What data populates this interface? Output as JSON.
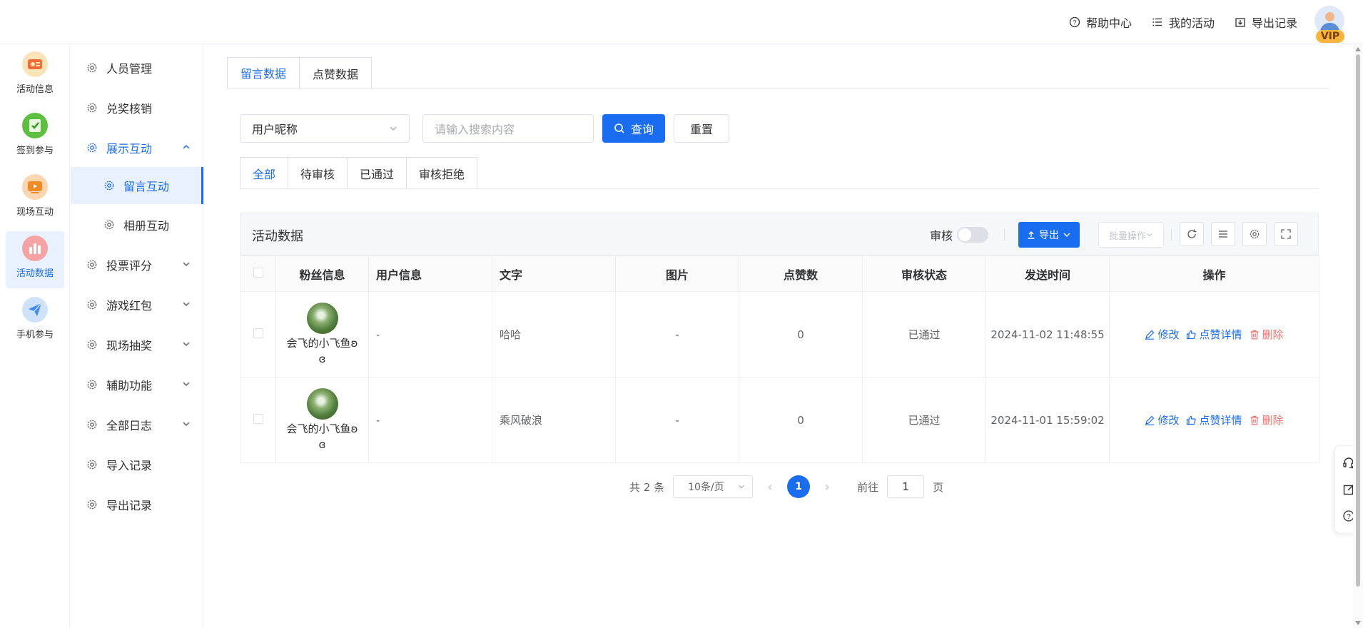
{
  "topbar": {
    "links": [
      {
        "label": "帮助中心",
        "icon": "help-circle-icon"
      },
      {
        "label": "我的活动",
        "icon": "list-icon"
      },
      {
        "label": "导出记录",
        "icon": "export-box-icon"
      }
    ],
    "vip_badge": "VIP"
  },
  "rail": {
    "items": [
      {
        "label": "活动信息",
        "icon": "activity-info-icon",
        "color": "#f5a623"
      },
      {
        "label": "签到参与",
        "icon": "checkin-icon",
        "color": "#43b244"
      },
      {
        "label": "现场互动",
        "icon": "live-interaction-icon",
        "color": "#f08a24"
      },
      {
        "label": "活动数据",
        "icon": "bar-chart-icon",
        "color": "#f26b6b"
      },
      {
        "label": "手机参与",
        "icon": "paper-plane-icon",
        "color": "#3d8bf2"
      }
    ]
  },
  "submenu": {
    "items": [
      {
        "label": "人员管理"
      },
      {
        "label": "兑奖核销"
      },
      {
        "label": "展示互动"
      },
      {
        "label": "留言互动"
      },
      {
        "label": "相册互动"
      },
      {
        "label": "投票评分"
      },
      {
        "label": "游戏红包"
      },
      {
        "label": "现场抽奖"
      },
      {
        "label": "辅助功能"
      },
      {
        "label": "全部日志"
      },
      {
        "label": "导入记录"
      },
      {
        "label": "导出记录"
      }
    ]
  },
  "main": {
    "top_tabs": [
      "留言数据",
      "点赞数据"
    ],
    "filter": {
      "select_value": "用户昵称",
      "search_placeholder": "请输入搜索内容",
      "query_label": "查询",
      "reset_label": "重置"
    },
    "status_tabs": [
      "全部",
      "待审核",
      "已通过",
      "审核拒绝"
    ],
    "panel": {
      "title": "活动数据",
      "audit_label": "审核",
      "export_label": "导出",
      "batch_label": "批量操作"
    },
    "table": {
      "headers": [
        "粉丝信息",
        "用户信息",
        "文字",
        "图片",
        "点赞数",
        "审核状态",
        "发送时间",
        "操作"
      ],
      "rows": [
        {
          "fan_name": "会飞的小飞鱼ʚ",
          "fan_name2": "ɞ",
          "user_info": "-",
          "text": "哈哈",
          "image": "-",
          "likes": "0",
          "status": "已通过",
          "time": "2024-11-02 11:48:55"
        },
        {
          "fan_name": "会飞的小飞鱼ʚ",
          "fan_name2": "ɞ",
          "user_info": "-",
          "text": "乘风破浪",
          "image": "-",
          "likes": "0",
          "status": "已通过",
          "time": "2024-11-01 15:59:02"
        }
      ],
      "actions": {
        "edit": "修改",
        "like_detail": "点赞详情",
        "delete": "删除"
      }
    },
    "pager": {
      "total": "共 2 条",
      "page_size": "10条/页",
      "current": "1",
      "goto_prefix": "前往",
      "goto_value": "1",
      "goto_suffix": "页"
    }
  },
  "colors": {
    "primary": "#1a6cf0",
    "danger": "#f56c6c"
  }
}
